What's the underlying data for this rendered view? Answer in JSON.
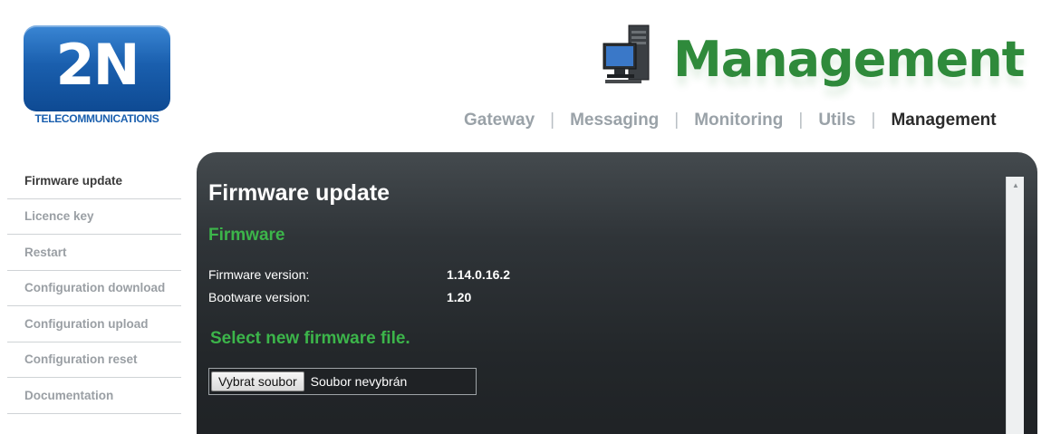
{
  "header": {
    "logo_mark": "2N",
    "logo_subtitle": "TELECOMMUNICATIONS",
    "section_title": "Management"
  },
  "topnav": {
    "items": [
      {
        "label": "Gateway",
        "active": false
      },
      {
        "label": "Messaging",
        "active": false
      },
      {
        "label": "Monitoring",
        "active": false
      },
      {
        "label": "Utils",
        "active": false
      },
      {
        "label": "Management",
        "active": true
      }
    ],
    "separator": "|"
  },
  "sidebar": {
    "items": [
      {
        "label": "Firmware update",
        "active": true
      },
      {
        "label": "Licence key",
        "active": false
      },
      {
        "label": "Restart",
        "active": false
      },
      {
        "label": "Configuration download",
        "active": false
      },
      {
        "label": "Configuration upload",
        "active": false
      },
      {
        "label": "Configuration reset",
        "active": false
      },
      {
        "label": "Documentation",
        "active": false
      }
    ]
  },
  "content": {
    "page_title": "Firmware update",
    "section_title": "Firmware",
    "firmware_version_label": "Firmware version:",
    "firmware_version_value": "1.14.0.16.2",
    "bootware_version_label": "Bootware version:",
    "bootware_version_value": "1.20",
    "select_title": "Select new firmware file.",
    "file_button_label": "Vybrat soubor",
    "file_status": "Soubor nevybrán"
  },
  "colors": {
    "brand_blue": "#1a5fae",
    "accent_green": "#3cb54a",
    "title_green": "#2f8a3b",
    "panel_dark": "#23272a"
  },
  "icons": {
    "scroll_up": "▲"
  }
}
